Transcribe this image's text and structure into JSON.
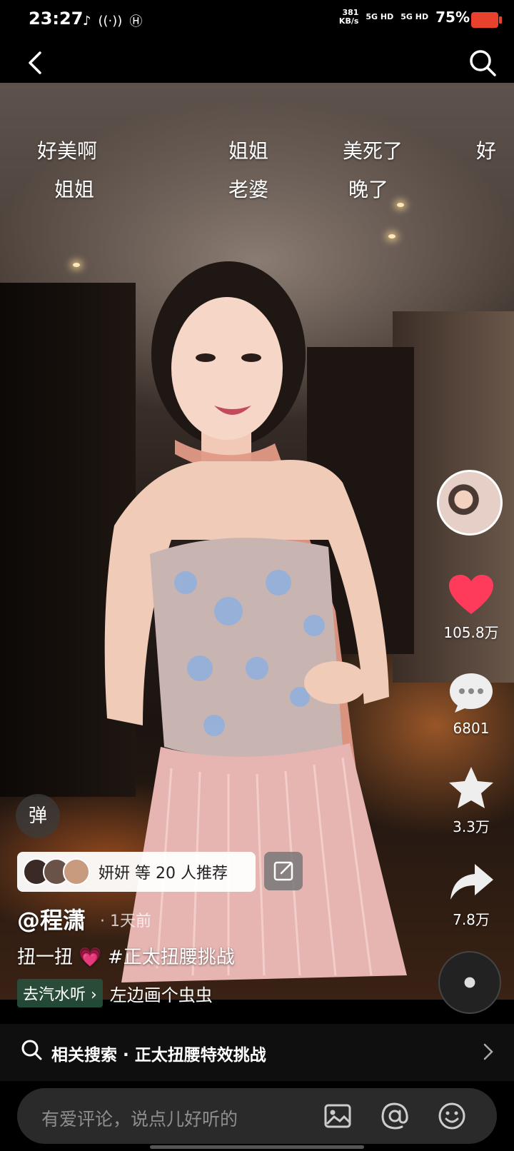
{
  "status_bar": {
    "time": "23:27",
    "left_icons": [
      "tiktok-icon",
      "nfc-icon",
      "hd-icon"
    ],
    "net_speed_value": "381",
    "net_speed_unit": "KB/s",
    "sim1": "5G HD",
    "sim2": "5G HD",
    "battery_pct": "75%"
  },
  "nav": {
    "back_icon": "chevron-left-icon",
    "search_icon": "search-icon"
  },
  "danmaku": [
    "好美啊",
    "姐姐",
    "美死了",
    "好",
    "姐姐",
    "老婆",
    "晚了"
  ],
  "actions": {
    "likes": "105.8万",
    "comments": "6801",
    "favorites": "3.3万",
    "shares": "7.8万"
  },
  "overlay": {
    "danmu_toggle": "弹",
    "recommend_text": "妍妍 等 20 人推荐",
    "author": "@程潇",
    "post_time": "· 1天前",
    "caption_a": "扭一扭",
    "caption_emoji": "💗",
    "caption_b": "#正太扭腰挑战",
    "music_app": "去汽水听 ›",
    "music_title": "左边画个虫虫"
  },
  "related": {
    "label": "相关搜索 · 正太扭腰特效挑战"
  },
  "comment": {
    "placeholder": "有爱评论，说点儿好听的"
  },
  "colors": {
    "like_red": "#ff3b5c",
    "battery_red": "#e8412c",
    "music_green": "#285a3c"
  }
}
